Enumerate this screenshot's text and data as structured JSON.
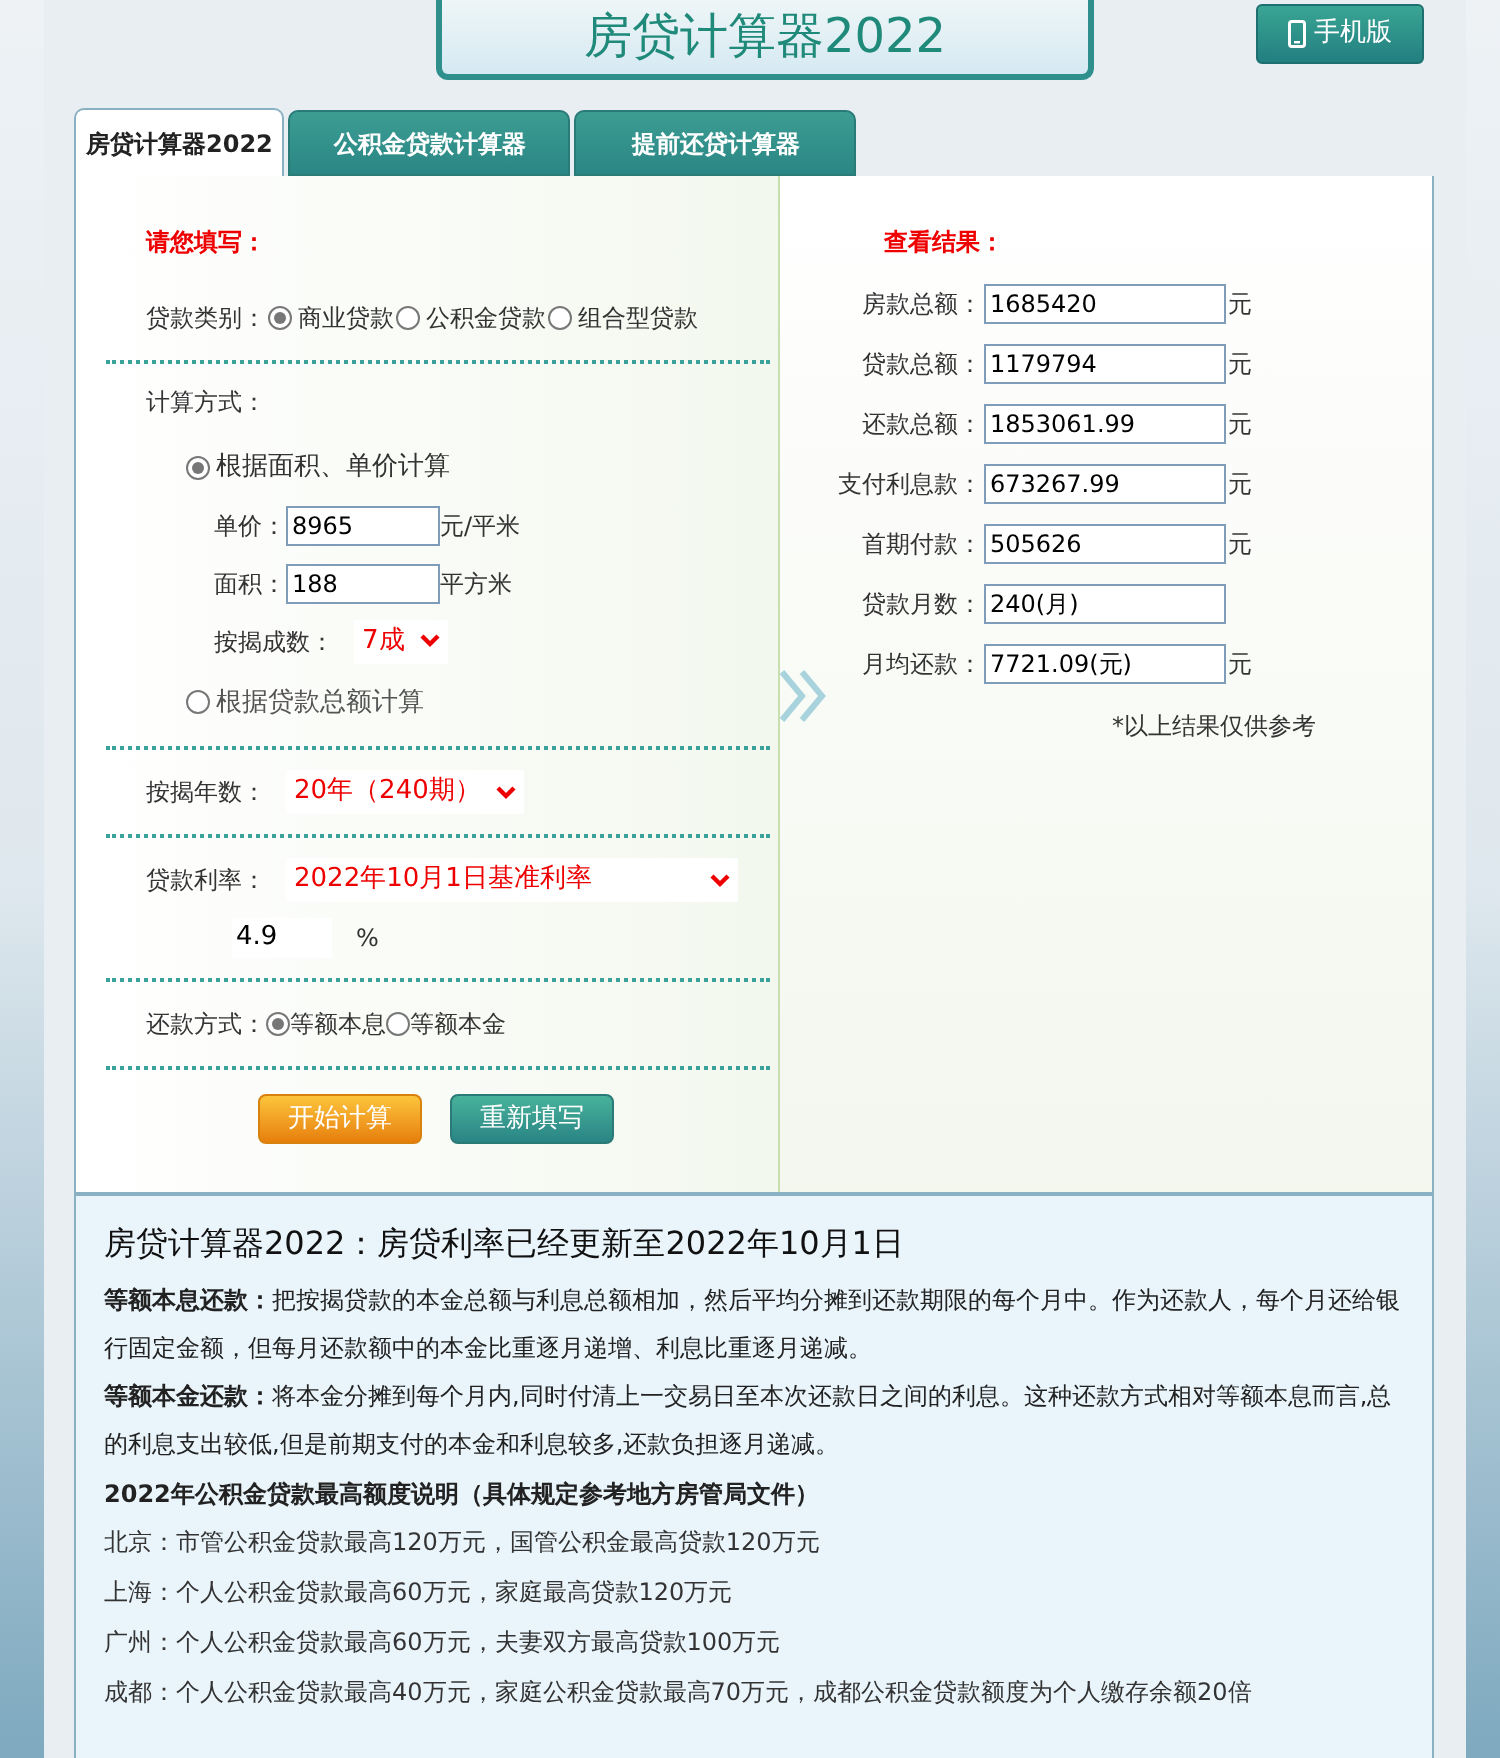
{
  "header": {
    "title": "房贷计算器2022",
    "mobile_button": "手机版"
  },
  "tabs": [
    {
      "label": "房贷计算器2022",
      "selected": true
    },
    {
      "label": "公积金贷款计算器",
      "selected": false
    },
    {
      "label": "提前还贷计算器",
      "selected": false
    }
  ],
  "form": {
    "heading": "请您填写：",
    "loan_type": {
      "label": "贷款类别：",
      "options": [
        {
          "label": "商业贷款",
          "selected": true
        },
        {
          "label": "公积金贷款",
          "selected": false
        },
        {
          "label": "组合型贷款",
          "selected": false
        }
      ]
    },
    "calc_method": {
      "label": "计算方式：",
      "options": [
        {
          "kind": "area",
          "label": "根据面积、单价计算",
          "selected": true,
          "fields": [
            {
              "label": "单价：",
              "value": "8965",
              "unit": "元/平米"
            },
            {
              "label": "面积：",
              "value": "188",
              "unit": "平方米"
            }
          ],
          "down_payment": {
            "label": "按揭成数：",
            "value": "7成"
          }
        },
        {
          "kind": "total",
          "label": "根据贷款总额计算",
          "selected": false
        }
      ]
    },
    "years": {
      "label": "按揭年数：",
      "value": "20年（240期）"
    },
    "rate": {
      "label": "贷款利率：",
      "value": "2022年10月1日基准利率",
      "input": "4.9",
      "unit": "%"
    },
    "repay": {
      "label": "还款方式：",
      "options": [
        {
          "label": "等额本息",
          "selected": true
        },
        {
          "label": "等额本金",
          "selected": false
        }
      ]
    },
    "buttons": [
      {
        "label": "开始计算",
        "kind": "primary"
      },
      {
        "label": "重新填写",
        "kind": "secondary"
      }
    ]
  },
  "results": {
    "heading": "查看结果：",
    "rows": [
      {
        "label": "房款总额：",
        "value": "1685420",
        "unit": "元"
      },
      {
        "label": "贷款总额：",
        "value": "1179794",
        "unit": "元"
      },
      {
        "label": "还款总额：",
        "value": "1853061.99",
        "unit": "元"
      },
      {
        "label": "支付利息款：",
        "value": "673267.99",
        "unit": "元"
      },
      {
        "label": "首期付款：",
        "value": "505626",
        "unit": "元"
      },
      {
        "label": "贷款月数：",
        "value": "240(月)"
      },
      {
        "label": "月均还款：",
        "value": "7721.09(元)",
        "unit": "元"
      }
    ],
    "note": "*以上结果仅供参考"
  },
  "info": {
    "title": "房贷计算器2022：房贷利率已经更新至2022年10月1日",
    "paragraphs": [
      "**等额本息还款：**把按揭贷款的本金总额与利息总额相加，然后平均分摊到还款期限的每个月中。作为还款人，每个月还给银行固定金额，但每月还款额中的本金比重逐月递增、利息比重逐月递减。",
      "**等额本金还款：**将本金分摊到每个月内,同时付清上一交易日至本次还款日之间的利息。这种还款方式相对等额本息而言,总的利息支出较低,但是前期支付的本金和利息较多,还款负担逐月递减。"
    ],
    "subheading": "2022年公积金贷款最高额度说明（具体规定参考地方房管局文件）",
    "cities": [
      "北京：市管公积金贷款最高120万元，国管公积金最高贷款120万元",
      "上海：个人公积金贷款最高60万元，家庭最高贷款120万元",
      "广州：个人公积金贷款最高60万元，夫妻双方最高贷款100万元",
      "成都：个人公积金贷款最高40万元，家庭公积金贷款最高70万元，成都公积金贷款额度为个人缴存余额20倍"
    ]
  }
}
